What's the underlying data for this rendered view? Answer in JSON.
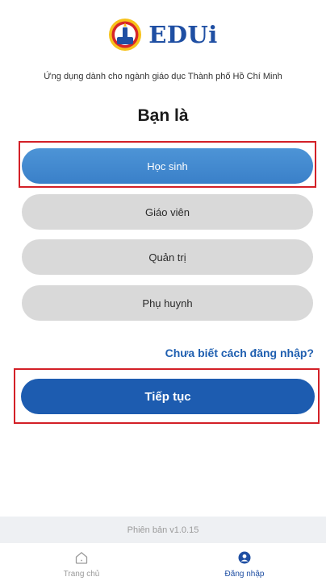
{
  "brand": {
    "name": "EDUi",
    "subtitle": "Ứng dụng dành cho ngành giáo dục Thành phố Hồ Chí Minh"
  },
  "role_prompt": "Bạn là",
  "roles": [
    {
      "label": "Học sinh",
      "selected": true
    },
    {
      "label": "Giáo viên",
      "selected": false
    },
    {
      "label": "Quản trị",
      "selected": false
    },
    {
      "label": "Phụ huynh",
      "selected": false
    }
  ],
  "help_link": "Chưa biết cách đăng nhập?",
  "continue_label": "Tiếp tục",
  "version": "Phiên bản v1.0.15",
  "bottom_nav": [
    {
      "label": "Trang chủ",
      "icon": "home-icon",
      "active": false
    },
    {
      "label": "Đăng nhập",
      "icon": "user-icon",
      "active": true
    }
  ],
  "colors": {
    "brand": "#1f4fa3",
    "selected_role": "#3a80c9",
    "unselected_role": "#d9d9d9",
    "primary_button": "#1d5cb0",
    "highlight": "#d32027"
  }
}
